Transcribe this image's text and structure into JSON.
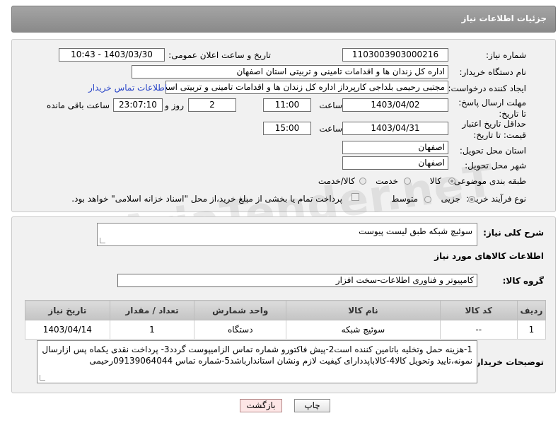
{
  "header": {
    "title": "جزئیات اطلاعات نیاز"
  },
  "fields": {
    "need_number_label": "شماره نیاز:",
    "need_number": "1103003903000216",
    "announce_label": "تاریخ و ساعت اعلان عمومی:",
    "announce_value": "1403/03/30 - 10:43",
    "buyer_org_label": "نام دستگاه خریدار:",
    "buyer_org": "اداره کل زندان ها و اقدامات تامینی و تربیتی استان اصفهان",
    "creator_label": "ایجاد کننده درخواست:",
    "creator": "مجتبی رحیمی بلداجی کارپرداز اداره کل زندان ها و اقدامات تامینی و تربیتی است",
    "buyer_contact_link": "اطلاعات تماس خریدار",
    "deadline_label": "مهلت ارسال پاسخ: تا تاریخ:",
    "deadline_date": "1403/04/02",
    "time_label": "ساعت",
    "deadline_time": "11:00",
    "days_value": "2",
    "days_label": "روز و",
    "remaining_time": "23:07:10",
    "remaining_label": "ساعت باقی مانده",
    "validity_label": "حداقل تاریخ اعتبار قیمت: تا تاریخ:",
    "validity_date": "1403/04/31",
    "validity_time": "15:00",
    "province_label": "استان محل تحویل:",
    "province": "اصفهان",
    "city_label": "شهر محل تحویل:",
    "city": "اصفهان",
    "category_label": "طبقه بندی موضوعی:",
    "category_options": [
      "کالا",
      "خدمت",
      "کالا/خدمت"
    ],
    "process_label": "نوع فرآیند خرید :",
    "process_options": [
      "جزیی",
      "متوسط"
    ],
    "payment_note": "پرداخت تمام یا بخشی از مبلغ خرید،از محل \"اسناد خزانه اسلامی\" خواهد بود."
  },
  "general": {
    "desc_label": "شرح کلی نیاز:",
    "desc_value": "سوئیچ شبکه طبق لیست پیوست",
    "goods_info_title": "اطلاعات کالاهای مورد نیاز",
    "goods_group_label": "گروه کالا:",
    "goods_group_value": "کامپیوتر و فناوری اطلاعات-سخت افزار"
  },
  "table": {
    "headers": [
      "ردیف",
      "کد کالا",
      "نام کالا",
      "واحد شمارش",
      "تعداد / مقدار",
      "تاریخ نیاز"
    ],
    "rows": [
      [
        "1",
        "--",
        "سوئیچ شبکه",
        "دستگاه",
        "1",
        "1403/04/14"
      ]
    ]
  },
  "buyer_notes": {
    "label": "توضیحات خریدار:",
    "text": "1-هزینه حمل وتخلیه باتامین کننده است2-پیش فاکتورو شماره تماس الزامیپوست گردد3- پرداخت نقدی یکماه  پس ازارسال نمونه،تایید وتحویل کالا4-کالاباپددارای کیفیت لازم ونشان استاندارباشد5-شماره تماس 09139064044رحیمی"
  },
  "buttons": {
    "print": "چاپ",
    "back": "بازگشت"
  },
  "watermark": "AriaTender.neT",
  "colors": {
    "header_bg": "#999999",
    "link": "#2a46c8",
    "back_button_bg": "#fde6e6"
  }
}
